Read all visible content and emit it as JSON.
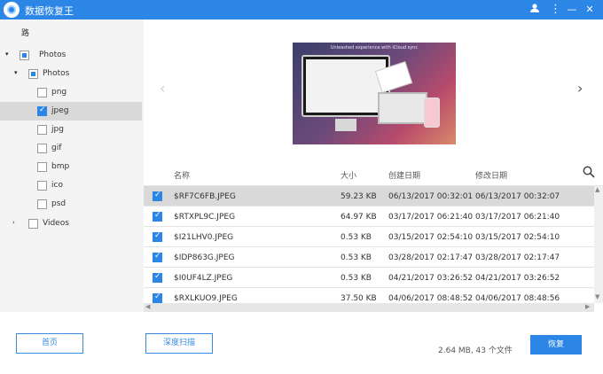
{
  "app": {
    "title": "数据恢复王"
  },
  "sidebar": {
    "path_label": "路",
    "tree": [
      {
        "label": "Photos",
        "state": "partial",
        "arrow": "▾"
      },
      {
        "label": "Photos",
        "state": "partial",
        "arrow": "▾"
      },
      {
        "label": "png",
        "state": "unchecked"
      },
      {
        "label": "jpeg",
        "state": "checked",
        "selected": true
      },
      {
        "label": "jpg",
        "state": "unchecked"
      },
      {
        "label": "gif",
        "state": "unchecked"
      },
      {
        "label": "bmp",
        "state": "unchecked"
      },
      {
        "label": "ico",
        "state": "unchecked"
      },
      {
        "label": "psd",
        "state": "unchecked"
      },
      {
        "label": "Videos",
        "state": "unchecked",
        "arrow": "›"
      }
    ]
  },
  "preview": {
    "caption": "Unleashed experience with iCloud sync",
    "prev_arrow": "‹",
    "next_arrow": "›"
  },
  "table": {
    "columns": {
      "name": "名称",
      "size": "大小",
      "created": "创建日期",
      "modified": "修改日期"
    },
    "rows": [
      {
        "name": "$RF7C6FB.JPEG",
        "size": "59.23 KB",
        "created": "06/13/2017 00:32:01",
        "modified": "06/13/2017 00:32:07",
        "highlight": true
      },
      {
        "name": "$RTXPL9C.JPEG",
        "size": "64.97 KB",
        "created": "03/17/2017 06:21:40",
        "modified": "03/17/2017 06:21:40"
      },
      {
        "name": "$I21LHV0.JPEG",
        "size": "0.53 KB",
        "created": "03/15/2017 02:54:10",
        "modified": "03/15/2017 02:54:10"
      },
      {
        "name": "$IDP863G.JPEG",
        "size": "0.53 KB",
        "created": "03/28/2017 02:17:47",
        "modified": "03/28/2017 02:17:47"
      },
      {
        "name": "$I0UF4LZ.JPEG",
        "size": "0.53 KB",
        "created": "04/21/2017 03:26:52",
        "modified": "04/21/2017 03:26:52"
      },
      {
        "name": "$RXLKUO9.JPEG",
        "size": "37.50 KB",
        "created": "04/06/2017 08:48:52",
        "modified": "04/06/2017 08:48:56"
      }
    ]
  },
  "footer": {
    "home_label": "首页",
    "deep_scan_label": "深度扫描",
    "summary": "2.64 MB, 43 个文件",
    "recover_label": "恢复"
  },
  "colors": {
    "accent": "#2b86e6",
    "selected_row": "#d9d9d9"
  },
  "icons": [
    "app-logo-icon",
    "user-icon",
    "more-menu-icon",
    "minimize-icon",
    "close-icon",
    "search-icon"
  ]
}
